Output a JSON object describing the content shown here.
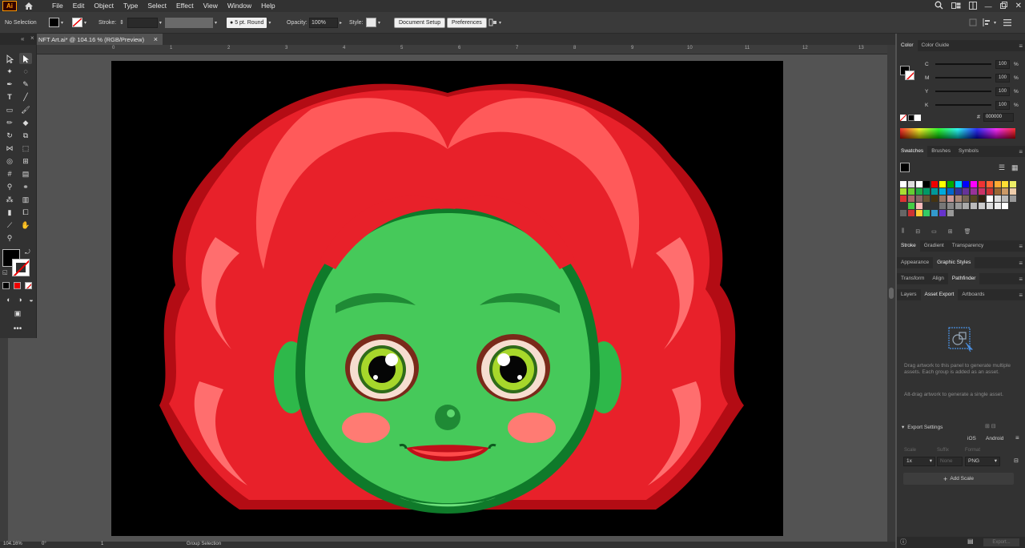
{
  "menubar": {
    "logo": "Ai",
    "items": [
      "File",
      "Edit",
      "Object",
      "Type",
      "Select",
      "Effect",
      "View",
      "Window",
      "Help"
    ]
  },
  "controlbar": {
    "selection": "No Selection",
    "stroke_label": "Stroke:",
    "brush": "5 pt. Round",
    "opacity_label": "Opacity:",
    "opacity_value": "100%",
    "style_label": "Style:",
    "document_setup": "Document Setup",
    "preferences": "Preferences"
  },
  "document_tab": {
    "title": "NFT Art.ai* @ 104.16 % (RGB/Preview)",
    "close": "×"
  },
  "ruler": {
    "ticks": [
      "0",
      "1",
      "2",
      "3",
      "4",
      "5",
      "6",
      "7",
      "8",
      "9",
      "10",
      "11",
      "12",
      "13"
    ]
  },
  "color_panel": {
    "tabs": [
      "Color",
      "Color Guide"
    ],
    "channels": [
      {
        "label": "C",
        "value": "100",
        "unit": "%"
      },
      {
        "label": "M",
        "value": "100",
        "unit": "%"
      },
      {
        "label": "Y",
        "value": "100",
        "unit": "%"
      },
      {
        "label": "K",
        "value": "100",
        "unit": "%"
      }
    ],
    "hex": "000000"
  },
  "swatches_panel": {
    "tabs": [
      "Swatches",
      "Brushes",
      "Symbols"
    ]
  },
  "stroke_panel": {
    "tabs": [
      "Stroke",
      "Gradient",
      "Transparency"
    ]
  },
  "appearance_panel": {
    "tabs": [
      "Appearance",
      "Graphic Styles"
    ]
  },
  "transform_panel": {
    "tabs": [
      "Transform",
      "Align",
      "Pathfinder"
    ]
  },
  "layers_panel": {
    "tabs": [
      "Layers",
      "Asset Export",
      "Artboards"
    ]
  },
  "asset_export": {
    "hint1": "Drag artwork to this panel to generate multiple assets. Each group is added as an asset.",
    "hint2": "Alt-drag artwork to generate a single asset.",
    "export_settings": "Export Settings",
    "ios": "iOS",
    "android": "Android",
    "scale_label": "Scale",
    "suffix_label": "Suffix",
    "format_label": "Format",
    "scale_value": "1x",
    "suffix_placeholder": "None",
    "format_value": "PNG",
    "add_scale": "Add Scale",
    "export_button": "Export..."
  },
  "statusbar": {
    "zoom": "104.16%",
    "rotation": "0°",
    "artboard": "1",
    "tool": "Group Selection"
  },
  "colors": {
    "artboard_bg": "#000000",
    "ui_dark": "#323232",
    "canvas": "#535353"
  }
}
